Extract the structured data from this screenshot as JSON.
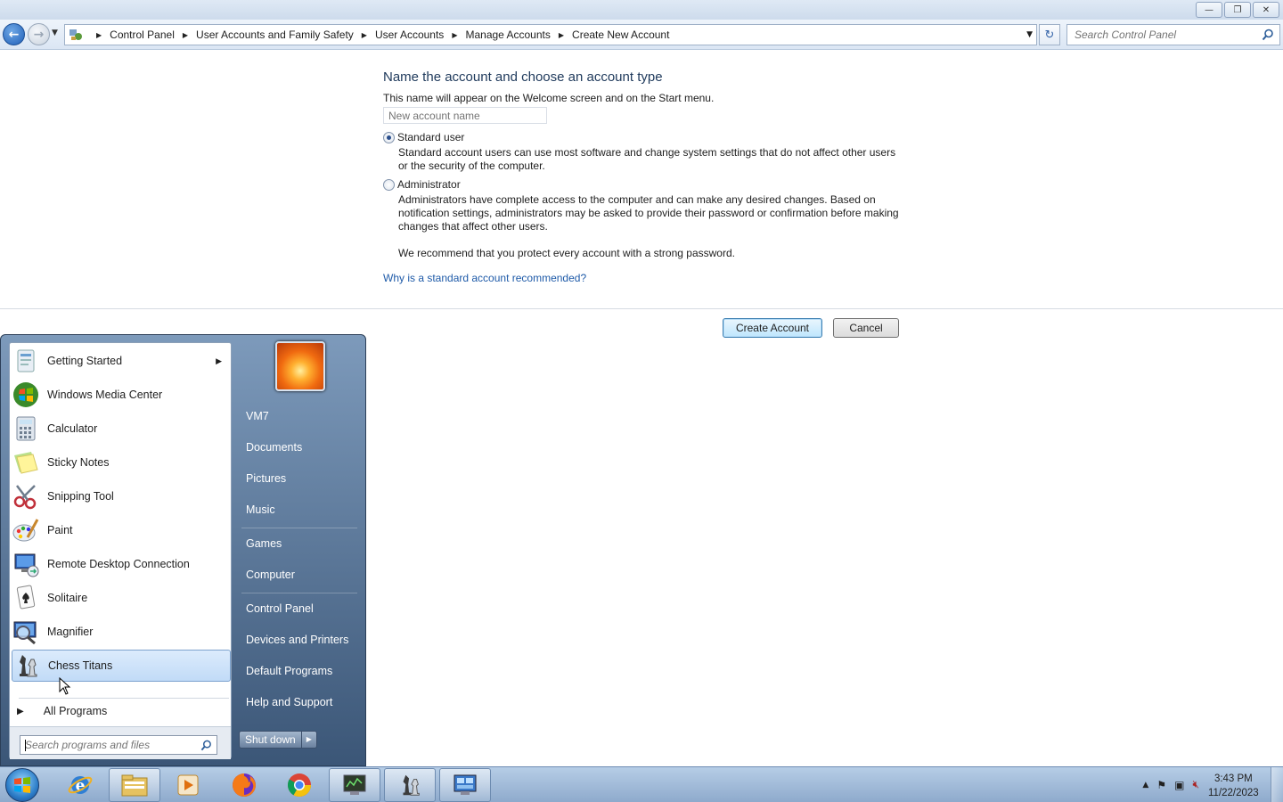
{
  "window": {
    "minimize": "—",
    "maximize": "❐",
    "close": "✕"
  },
  "nav": {
    "breadcrumbs": [
      "Control Panel",
      "User Accounts and Family Safety",
      "User Accounts",
      "Manage Accounts",
      "Create New Account"
    ],
    "search_placeholder": "Search Control Panel"
  },
  "form": {
    "heading": "Name the account and choose an account type",
    "description": "This name will appear on the Welcome screen and on the Start menu.",
    "name_placeholder": "New account name",
    "standard_label": "Standard user",
    "standard_desc": "Standard account users can use most software and change system settings that do not affect other users or the security of the computer.",
    "admin_label": "Administrator",
    "admin_desc": "Administrators have complete access to the computer and can make any desired changes. Based on notification settings, administrators may be asked to provide their password or confirmation before making changes that affect other users.",
    "recommend": "We recommend that you protect every account with a strong password.",
    "why_link": "Why is a standard account recommended?",
    "selected_type": "Standard user",
    "create_button": "Create Account",
    "cancel_button": "Cancel"
  },
  "start_menu": {
    "programs": [
      {
        "label": "Getting Started",
        "icon": "getting-started-icon",
        "has_submenu": true
      },
      {
        "label": "Windows Media Center",
        "icon": "media-center-icon"
      },
      {
        "label": "Calculator",
        "icon": "calculator-icon"
      },
      {
        "label": "Sticky Notes",
        "icon": "sticky-notes-icon"
      },
      {
        "label": "Snipping Tool",
        "icon": "snipping-tool-icon"
      },
      {
        "label": "Paint",
        "icon": "paint-icon"
      },
      {
        "label": "Remote Desktop Connection",
        "icon": "remote-desktop-icon"
      },
      {
        "label": "Solitaire",
        "icon": "solitaire-icon"
      },
      {
        "label": "Magnifier",
        "icon": "magnifier-icon"
      },
      {
        "label": "Chess Titans",
        "icon": "chess-icon",
        "highlighted": true
      }
    ],
    "all_programs": "All Programs",
    "search_placeholder": "Search programs and files",
    "right_items": [
      "VM7",
      "Documents",
      "Pictures",
      "Music",
      "Games",
      "Computer",
      "Control Panel",
      "Devices and Printers",
      "Default Programs",
      "Help and Support"
    ],
    "shutdown": "Shut down"
  },
  "taskbar": {
    "time": "3:43 PM",
    "date": "11/22/2023"
  }
}
